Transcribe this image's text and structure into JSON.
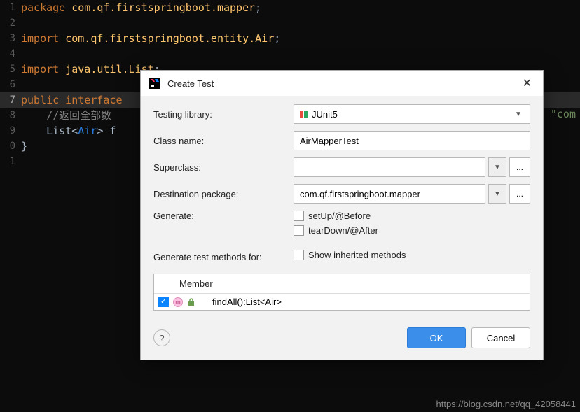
{
  "editor": {
    "lines": [
      {
        "n": "1",
        "seg": [
          {
            "c": "kw",
            "t": "package "
          },
          {
            "c": "pkg",
            "t": "com.qf.firstspringboot.mapper"
          },
          {
            "c": "plain",
            "t": ";"
          }
        ]
      },
      {
        "n": "2",
        "seg": []
      },
      {
        "n": "3",
        "seg": [
          {
            "c": "kw",
            "t": "import "
          },
          {
            "c": "pkg",
            "t": "com.qf.firstspringboot.entity.Air"
          },
          {
            "c": "plain",
            "t": ";"
          }
        ]
      },
      {
        "n": "4",
        "seg": []
      },
      {
        "n": "5",
        "seg": [
          {
            "c": "kw",
            "t": "import "
          },
          {
            "c": "pkg",
            "t": "java.util.List"
          },
          {
            "c": "plain",
            "t": ";"
          }
        ]
      },
      {
        "n": "6",
        "seg": []
      },
      {
        "n": "7",
        "seg": [
          {
            "c": "kw",
            "t": "public interface"
          }
        ],
        "active": true
      },
      {
        "n": "8",
        "seg": [
          {
            "c": "plain",
            "t": "    "
          },
          {
            "c": "cmt",
            "t": "//返回全部数"
          }
        ]
      },
      {
        "n": "9",
        "seg": [
          {
            "c": "plain",
            "t": "    List<"
          },
          {
            "c": "typ",
            "t": "Air"
          },
          {
            "c": "plain",
            "t": "> f"
          }
        ]
      },
      {
        "n": "0",
        "seg": [
          {
            "c": "plain",
            "t": "}"
          }
        ]
      },
      {
        "n": "1",
        "seg": []
      }
    ],
    "com_frag": "\"com"
  },
  "dialog": {
    "title": "Create Test",
    "labels": {
      "testingLibrary": "Testing library:",
      "className": "Class name:",
      "superclass": "Superclass:",
      "destPackage": "Destination package:",
      "generate": "Generate:",
      "genTestMethods": "Generate test methods for:",
      "setUp": "setUp/@Before",
      "tearDown": "tearDown/@After",
      "showInherited": "Show inherited methods",
      "memberHeader": "Member"
    },
    "values": {
      "testingLibrary": "JUnit5",
      "className": "AirMapperTest",
      "superclass": "",
      "destPackage": "com.qf.firstspringboot.mapper",
      "member0": "findAll():List<Air>"
    },
    "buttons": {
      "ok": "OK",
      "cancel": "Cancel",
      "more": "...",
      "help": "?"
    }
  },
  "watermark": "https://blog.csdn.net/qq_42058441"
}
